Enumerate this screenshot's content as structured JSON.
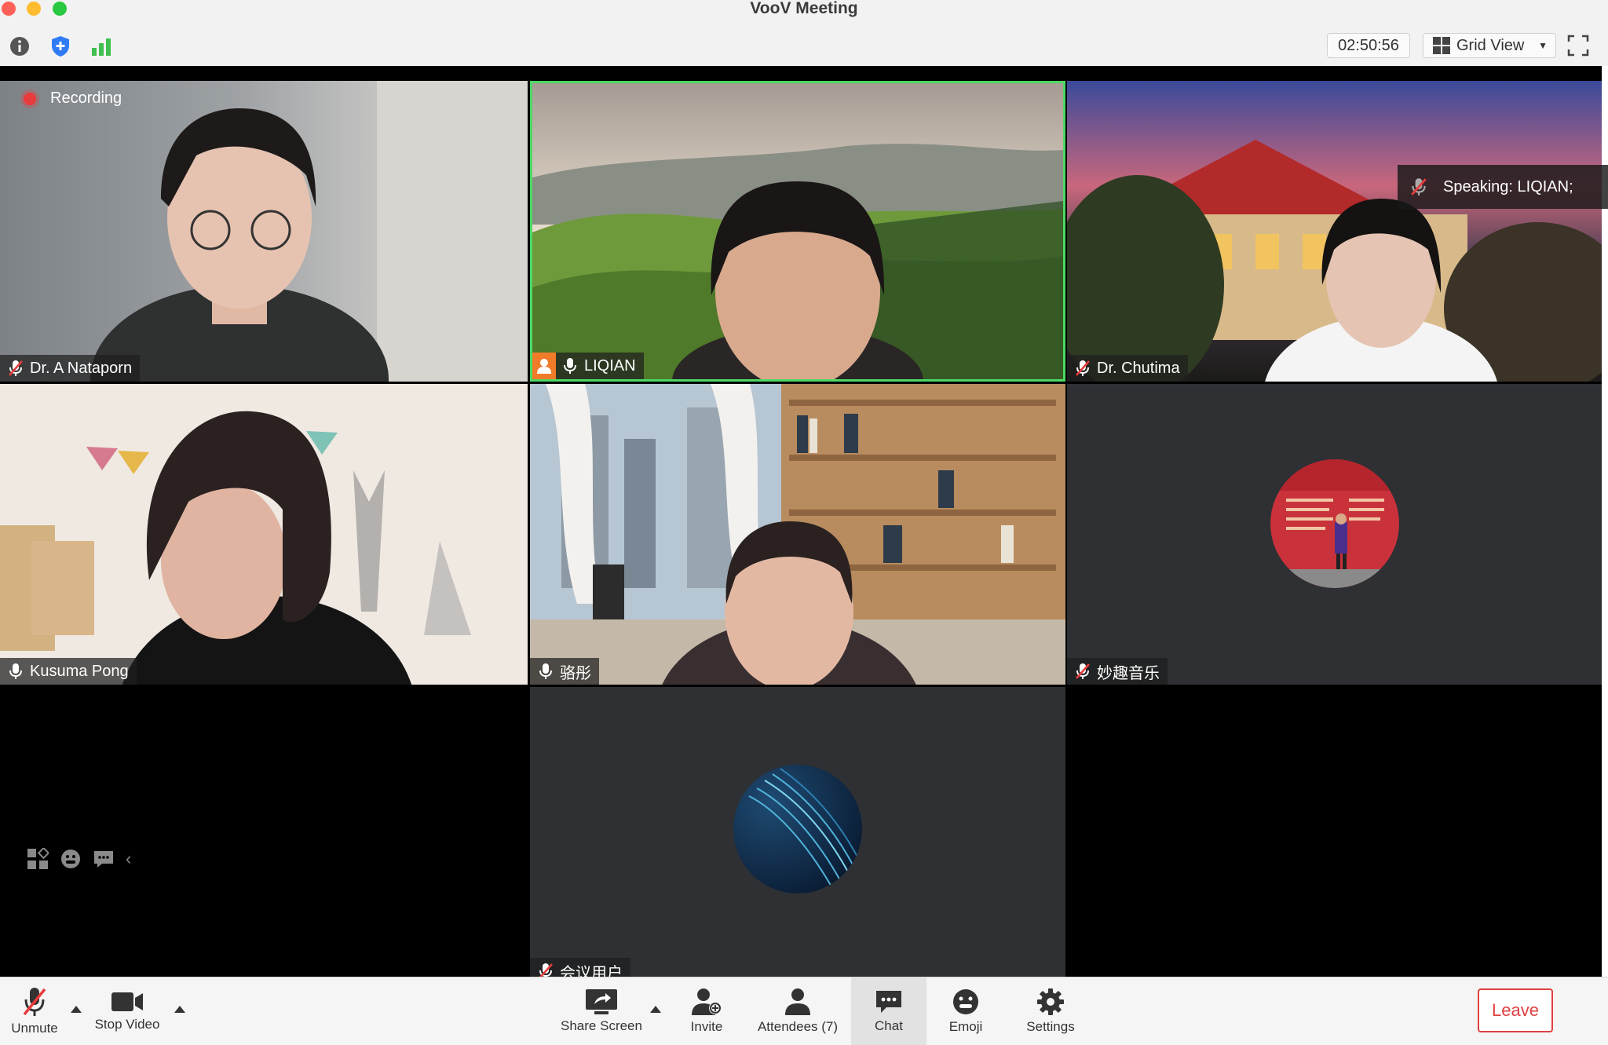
{
  "window": {
    "title": "VooV Meeting"
  },
  "toolbar": {
    "info_icon": "info-icon",
    "security_icon": "shield-icon",
    "network_icon": "signal-bars-icon",
    "timer": "02:50:56",
    "view_label": "Grid View"
  },
  "recording": {
    "label": "Recording"
  },
  "speaking": {
    "text": "Speaking: LIQIAN;"
  },
  "tiles": [
    {
      "name": "Dr. A Nataporn",
      "mic": "muted"
    },
    {
      "name": "LIQIAN",
      "mic": "on",
      "active_speaker": true
    },
    {
      "name": "Dr. Chutima",
      "mic": "muted"
    },
    {
      "name": "Kusuma Pong",
      "mic": "on"
    },
    {
      "name": "骆彤",
      "mic": "on"
    },
    {
      "name": "妙趣音乐",
      "mic": "muted"
    },
    {
      "name": "会议用户",
      "mic": "muted"
    }
  ],
  "bottom": {
    "unmute": "Unmute",
    "stop_video": "Stop Video",
    "share_screen": "Share Screen",
    "invite": "Invite",
    "attendees": "Attendees (7)",
    "chat": "Chat",
    "emoji": "Emoji",
    "settings": "Settings",
    "leave": "Leave"
  },
  "colors": {
    "accent_green": "#4cd964",
    "leave_red": "#e04040",
    "shield_blue": "#2f7bf5",
    "signal_green": "#3fbf4f"
  }
}
